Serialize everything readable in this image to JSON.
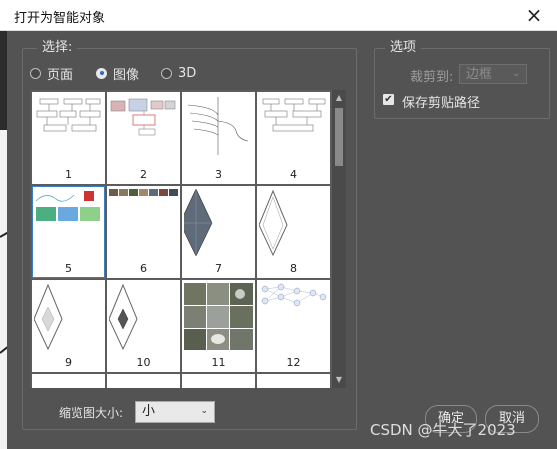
{
  "window": {
    "title": "打开为智能对象",
    "close_icon": "×"
  },
  "selection": {
    "legend": "选择:",
    "radios": [
      {
        "label": "页面",
        "checked": false
      },
      {
        "label": "图像",
        "checked": true
      },
      {
        "label": "3D",
        "checked": false
      }
    ]
  },
  "thumbnails": {
    "items": [
      "1",
      "2",
      "3",
      "4",
      "5",
      "6",
      "7",
      "8",
      "9",
      "10",
      "11",
      "12"
    ],
    "selected": "5"
  },
  "thumb_size": {
    "label": "缩览图大小:",
    "value": "小"
  },
  "options": {
    "legend": "选项",
    "crop_label": "裁剪到:",
    "crop_value": "边框",
    "save_clip_label": "保存剪贴路径",
    "save_clip_checked": true
  },
  "buttons": {
    "ok": "确定",
    "cancel": "取消"
  },
  "watermark": "CSDN @牛大了2023",
  "colors": {
    "dialog_bg": "#535353",
    "accent": "#2b6bd3",
    "selection_outline": "#3b7fc4"
  }
}
